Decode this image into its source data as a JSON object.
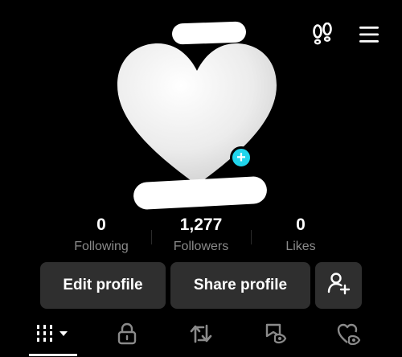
{
  "header": {
    "icons": [
      "footprints-icon",
      "menu-icon"
    ]
  },
  "profile": {
    "avatar": "white-heart",
    "add_badge": "+"
  },
  "stats": [
    {
      "value": "0",
      "label": "Following"
    },
    {
      "value": "1,277",
      "label": "Followers"
    },
    {
      "value": "0",
      "label": "Likes"
    }
  ],
  "actions": {
    "edit_profile": "Edit profile",
    "share_profile": "Share profile",
    "add_friend_icon": "add-user-icon"
  },
  "tabs": [
    {
      "icon": "videos-grid-icon",
      "selected": true
    },
    {
      "icon": "lock-icon",
      "selected": false
    },
    {
      "icon": "repost-icon",
      "selected": false
    },
    {
      "icon": "favorites-icon",
      "selected": false
    },
    {
      "icon": "liked-icon",
      "selected": false
    }
  ],
  "colors": {
    "background": "#000000",
    "button": "#2f2f2f",
    "label_gray": "#8a8a8a",
    "badge": "#20d5ec"
  }
}
